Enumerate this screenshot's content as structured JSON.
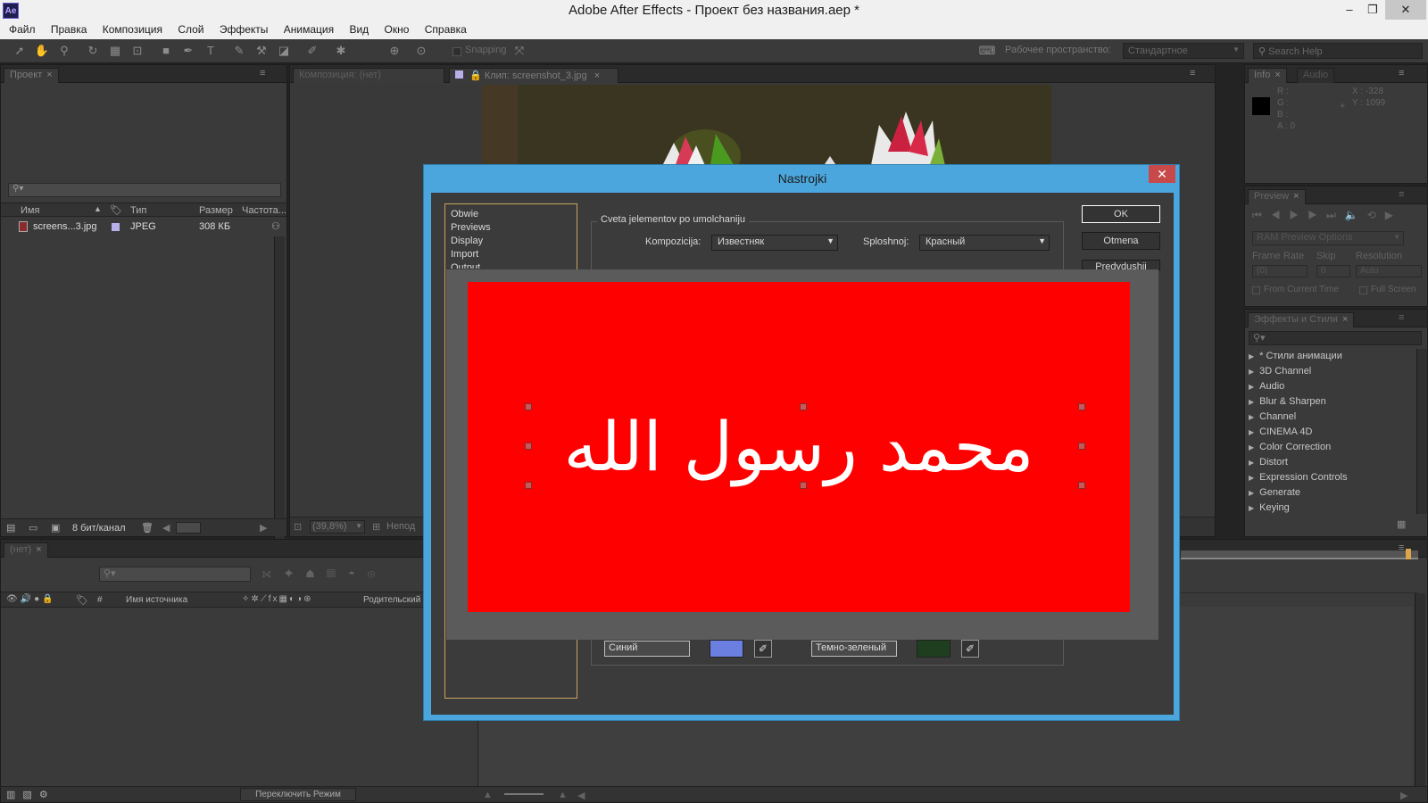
{
  "window": {
    "app_logo": "Ae",
    "title": "Adobe After Effects - Проект без названия.aep *",
    "minimize": "–",
    "restore": "❐",
    "close": "✕"
  },
  "menu": [
    "Файл",
    "Правка",
    "Композиция",
    "Слой",
    "Эффекты",
    "Анимация",
    "Вид",
    "Окно",
    "Справка"
  ],
  "toolbar": {
    "snapping": "Snapping",
    "workspace_label": "Рабочее пространство:",
    "workspace_value": "Стандартное",
    "search_placeholder": "Search Help"
  },
  "project_panel": {
    "tab": "Проект",
    "columns": [
      "Имя",
      "Тип",
      "Размер",
      "Частота..."
    ],
    "rows": [
      {
        "name": "screens...3.jpg",
        "type": "JPEG",
        "size": "308 КБ"
      }
    ],
    "bit_depth": "8 бит/канал"
  },
  "viewer": {
    "tab_comp": "Композиция: (нет)",
    "tab_clip": "Клип: screenshot_3.jpg",
    "zoom": "(39,8%)",
    "status": "Непод"
  },
  "info_panel": {
    "tab_info": "Info",
    "tab_audio": "Audio",
    "r": "R :",
    "g": "G :",
    "b": "B :",
    "a": "A : 0",
    "x": "X : -328",
    "y": "Y : 1099"
  },
  "preview_panel": {
    "tab": "Preview",
    "ram_options": "RAM Preview Options",
    "frame_rate": "Frame Rate",
    "skip": "Skip",
    "resolution": "Resolution",
    "frame_rate_val": "(0)",
    "skip_val": "0",
    "resolution_val": "Auto",
    "from_current": "From Current Time",
    "full_screen": "Full Screen"
  },
  "effects_panel": {
    "tab": "Эффекты и Стили",
    "items": [
      "* Стили анимации",
      "3D Channel",
      "Audio",
      "Blur & Sharpen",
      "Channel",
      "CINEMA 4D",
      "Color Correction",
      "Distort",
      "Expression Controls",
      "Generate",
      "Keying"
    ]
  },
  "timeline": {
    "tab": "(нет)",
    "col_source": "Имя источника",
    "col_num": "#",
    "col_parent": "Родительский",
    "toggle_mode": "Переключить Режим"
  },
  "dialog": {
    "title": "Nastrojki",
    "nav": [
      "Obwie",
      "Previews",
      "Display",
      "Import",
      "Output"
    ],
    "group_label": "Cveta jelementov po umolchaniju",
    "kompozicija_label": "Kompozicija:",
    "kompozicija_value": "Известняк",
    "sploshnoj_label": "Sploshnoj:",
    "sploshnoj_value": "Красный",
    "ok": "OK",
    "cancel": "Otmena",
    "prev": "Predydushij",
    "color1_name": "Синий",
    "color2_name": "Темно-зеленый",
    "color1": "#6b7fe0",
    "color2": "#1f3d1f"
  },
  "overlay_text": "محمد رسول الله",
  "colors": {
    "accent_blue": "#4ba6dd",
    "red": "#ff0000",
    "panel_bg": "#3a3a3a"
  }
}
